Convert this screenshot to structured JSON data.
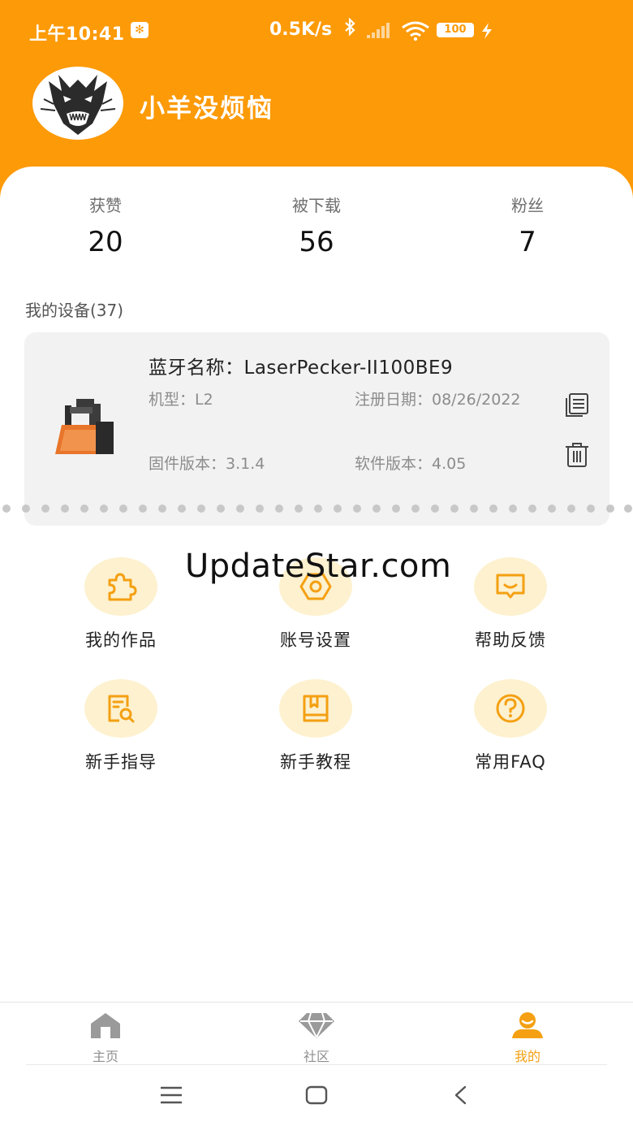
{
  "status_bar": {
    "time": "上午10:41",
    "speed": "0.5K/s",
    "battery": "100"
  },
  "profile": {
    "username": "小羊没烦恼"
  },
  "stats": [
    {
      "label": "获赞",
      "value": "20"
    },
    {
      "label": "被下载",
      "value": "56"
    },
    {
      "label": "粉丝",
      "value": "7"
    }
  ],
  "devices": {
    "title": "我的设备(37)",
    "card": {
      "bluetooth_name": "蓝牙名称：LaserPecker-II100BE9",
      "model": "机型：L2",
      "register_date": "注册日期：08/26/2022",
      "firmware": "固件版本：3.1.4",
      "software": "软件版本：4.05"
    }
  },
  "watermark": "UpdateStar.com",
  "menu": [
    {
      "label": "我的作品",
      "icon": "puzzle-icon"
    },
    {
      "label": "账号设置",
      "icon": "settings-hex-icon"
    },
    {
      "label": "帮助反馈",
      "icon": "feedback-icon"
    },
    {
      "label": "新手指导",
      "icon": "guide-search-icon"
    },
    {
      "label": "新手教程",
      "icon": "tutorial-book-icon"
    },
    {
      "label": "常用FAQ",
      "icon": "question-icon"
    }
  ],
  "tabbar": [
    {
      "label": "主页",
      "icon": "home-icon"
    },
    {
      "label": "社区",
      "icon": "diamond-icon"
    },
    {
      "label": "我的",
      "icon": "profile-icon",
      "active": true
    }
  ],
  "colors": {
    "brand_orange": "#fd9a07",
    "accent_light": "#fdf1cf",
    "icon_orange": "#f4a012"
  }
}
